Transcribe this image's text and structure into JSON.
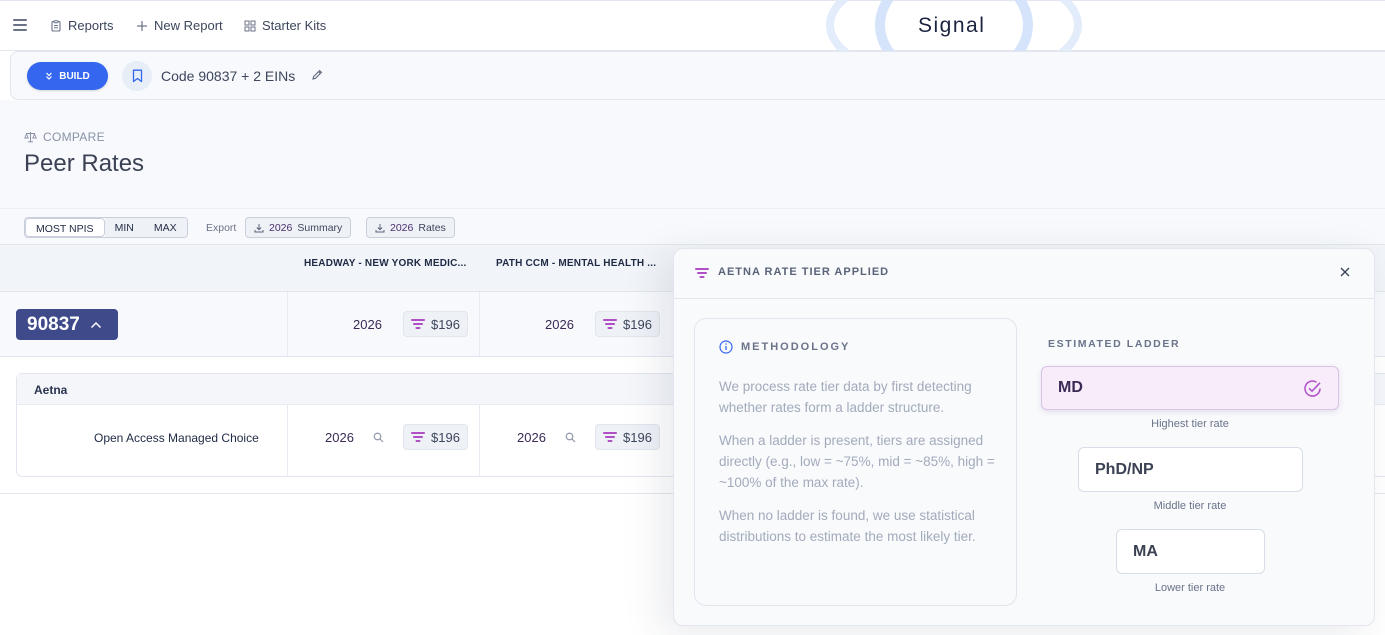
{
  "nav": {
    "reports": "Reports",
    "new_report": "New Report",
    "starter_kits": "Starter Kits",
    "brand": "Signal"
  },
  "buildbar": {
    "build_label": "BUILD",
    "report_title": "Code 90837 + 2 EINs"
  },
  "compare": {
    "eyebrow": "COMPARE",
    "title": "Peer Rates"
  },
  "controls": {
    "segments": [
      "MOST NPIS",
      "MIN",
      "MAX"
    ],
    "selected_segment": "MOST NPIS",
    "export_label": "Export",
    "export_summary_year": "2026",
    "export_summary_label": "Summary",
    "export_rates_year": "2026",
    "export_rates_label": "Rates"
  },
  "table": {
    "columns": [
      "HEADWAY - NEW YORK MEDIC...",
      "PATH CCM - MENTAL HEALTH ..."
    ],
    "code": "90837",
    "code_row": [
      {
        "year": "2026",
        "rate": "$196"
      },
      {
        "year": "2026",
        "rate": "$196"
      }
    ],
    "payer": "Aetna",
    "plan": "Open Access Managed Choice",
    "plan_row": [
      {
        "year": "2026",
        "rate": "$196"
      },
      {
        "year": "2026",
        "rate": "$196"
      }
    ]
  },
  "popover": {
    "title": "AETNA RATE TIER APPLIED",
    "methodology_title": "METHODOLOGY",
    "paragraphs": [
      "We process rate tier data by first detecting whether rates form a ladder structure.",
      "When a ladder is present, tiers are assigned directly (e.g., low = ~75%, mid = ~85%, high = ~100% of the max rate).",
      "When no ladder is found, we use statistical distributions to estimate the most likely tier."
    ],
    "ladder_title": "ESTIMATED LADDER",
    "tiers": [
      {
        "label": "MD",
        "caption": "Highest tier rate",
        "selected": true
      },
      {
        "label": "PhD/NP",
        "caption": "Middle tier rate",
        "selected": false
      },
      {
        "label": "MA",
        "caption": "Lower tier rate",
        "selected": false
      }
    ]
  },
  "colors": {
    "accent_blue": "#3566ef",
    "code_badge": "#3e4a8a",
    "tier_purple": "#b04fc6"
  }
}
